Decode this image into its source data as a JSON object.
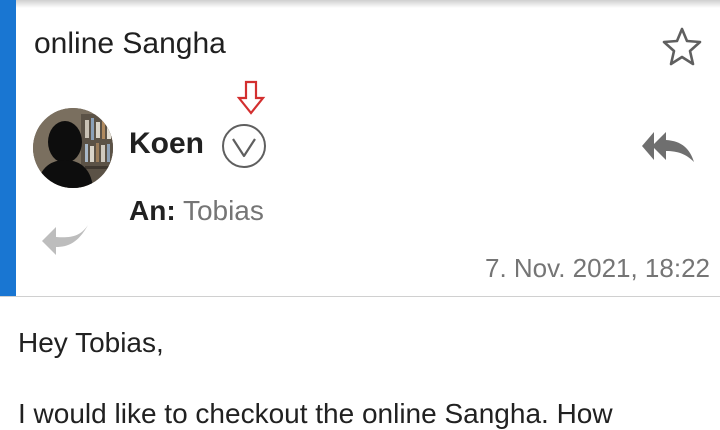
{
  "email": {
    "subject": "online Sangha",
    "sender_name": "Koen",
    "recipient_label": "An:",
    "recipient_name": "Tobias",
    "timestamp": "7. Nov. 2021, 18:22",
    "body_greeting": "Hey Tobias,",
    "body_line_1": "I would like to checkout the online Sangha. How"
  },
  "icons": {
    "star": "star-outline-icon",
    "expand": "chevron-down-circle-icon",
    "annotation": "red-down-arrow-icon",
    "reply_all": "reply-all-icon",
    "reply": "reply-icon"
  },
  "colors": {
    "accent": "#1976d2",
    "annotation": "#d32f2f",
    "muted_text": "#757575"
  }
}
